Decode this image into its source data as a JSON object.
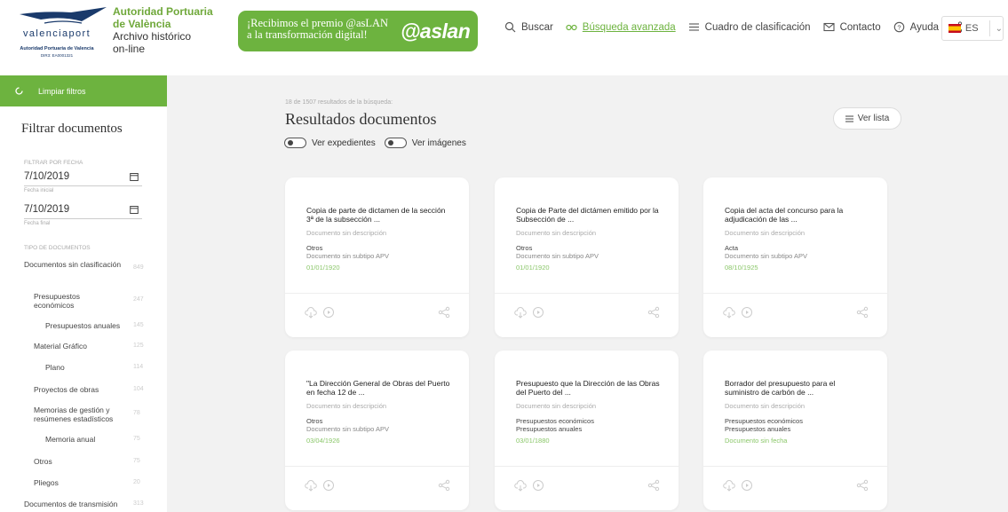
{
  "header": {
    "logo": {
      "wordmark": "valenciaport",
      "subtitle": "Autoridad Portuaria de Valencia",
      "dir3": "DIR3: EA0001321"
    },
    "institution": {
      "line1": "Autoridad Portuaria",
      "line2": "de València",
      "line3": "Archivo histórico",
      "line4": "on-line"
    },
    "award": {
      "line1": "¡Recibimos el premio @asLAN",
      "line2": "a la transformación digital!",
      "brand": "@aslan",
      "color": "#6db33f"
    },
    "nav": {
      "search": "Buscar",
      "advanced": "Búsqueda avanzada",
      "classification": "Cuadro de clasificación",
      "contact": "Contacto",
      "help": "Ayuda"
    },
    "language": {
      "code": "ES"
    }
  },
  "sidebar": {
    "clear_filters": "Limpiar filtros",
    "title": "Filtrar documentos",
    "filter_by_date": "FILTRAR POR FECHA",
    "start_date": "7/10/2019",
    "start_note": "Fecha inicial",
    "end_date": "7/10/2019",
    "end_note": "Fecha final",
    "doc_types_label": "TIPO DE DOCUMENTOS",
    "doc_types": [
      {
        "label": "Documentos sin clasificación",
        "count": "849"
      },
      {
        "label": "Presupuestos económicos",
        "count": "247"
      },
      {
        "label": "Presupuestos anuales",
        "count": "145"
      },
      {
        "label": "Material Gráfico",
        "count": "125"
      },
      {
        "label": "Plano",
        "count": "114"
      },
      {
        "label": "Proyectos de obras",
        "count": "104"
      },
      {
        "label": "Memorias de gestión y resúmenes estadísticos",
        "count": "78"
      },
      {
        "label": "Memoria anual",
        "count": "75"
      },
      {
        "label": "Otros",
        "count": "75"
      },
      {
        "label": "Pliegos",
        "count": "20"
      },
      {
        "label": "Documentos de transmisión",
        "count": "313"
      }
    ]
  },
  "main": {
    "results_count": "18 de 1507 resultados de la búsqueda:",
    "title": "Resultados documentos",
    "view_list": "Ver lista",
    "toggle_expedientes": "Ver expedientes",
    "toggle_imagenes": "Ver imágenes",
    "cards": [
      {
        "title": "Copia de parte de dictamen de la sección 3ª de la subsección ...",
        "desc": "Documento sin descripción",
        "type": "Otros",
        "subtype": "Documento sin subtipo APV",
        "date": "01/01/1920"
      },
      {
        "title": "Copia de Parte del dictámen emitido por la Subsección de ...",
        "desc": "Documento sin descripción",
        "type": "Otros",
        "subtype": "Documento sin subtipo APV",
        "date": "01/01/1920"
      },
      {
        "title": "Copia del acta del concurso para la adjudicación de las ...",
        "desc": "Documento sin descripción",
        "type": "Acta",
        "subtype": "Documento sin subtipo APV",
        "date": "08/10/1925"
      },
      {
        "title": "\"La Dirección General de Obras del Puerto en fecha 12 de ...",
        "desc": "Documento sin descripción",
        "type": "Otros",
        "subtype": "Documento sin subtipo APV",
        "date": "03/04/1926"
      },
      {
        "title": "Presupuesto que la Dirección de las Obras del Puerto del ...",
        "desc": "Documento sin descripción",
        "type": "Presupuestos económicos",
        "subtype": "Presupuestos anuales",
        "date": "03/01/1880"
      },
      {
        "title": "Borrador del presupuesto para el suministro de carbón de ...",
        "desc": "Documento sin descripción",
        "type": "Presupuestos económicos",
        "subtype": "Presupuestos anuales",
        "date": "Documento sin fecha"
      }
    ]
  }
}
